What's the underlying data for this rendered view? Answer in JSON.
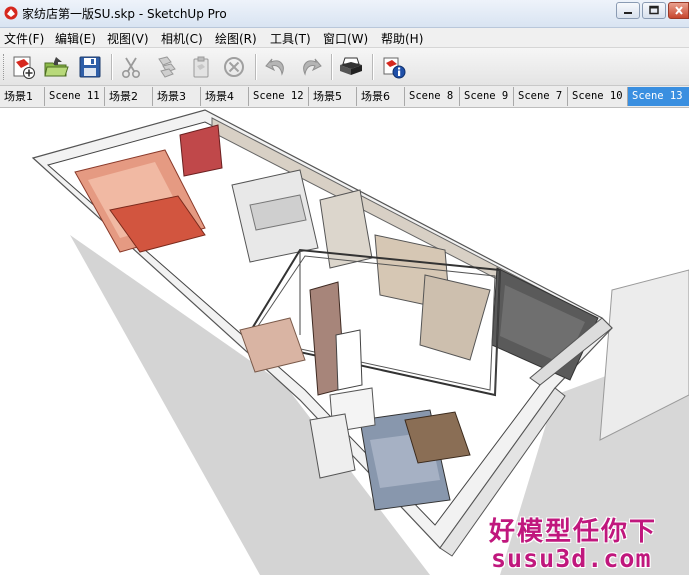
{
  "window": {
    "title": "家纺店第一版SU.skp - SketchUp Pro"
  },
  "menu": {
    "items": [
      {
        "label": "文件(F)"
      },
      {
        "label": "编辑(E)"
      },
      {
        "label": "视图(V)"
      },
      {
        "label": "相机(C)"
      },
      {
        "label": "绘图(R)"
      },
      {
        "label": "工具(T)"
      },
      {
        "label": "窗口(W)"
      },
      {
        "label": "帮助(H)"
      }
    ]
  },
  "toolbar": {
    "buttons": [
      {
        "icon": "new-file-icon"
      },
      {
        "icon": "open-folder-icon"
      },
      {
        "icon": "save-disk-icon"
      },
      {
        "icon": "cut-scissors-icon"
      },
      {
        "icon": "copy-icon"
      },
      {
        "icon": "paste-icon"
      },
      {
        "icon": "erase-icon"
      },
      {
        "icon": "undo-icon"
      },
      {
        "icon": "redo-icon"
      },
      {
        "icon": "print-icon"
      },
      {
        "icon": "model-info-icon"
      }
    ]
  },
  "scenes": {
    "tabs": [
      {
        "label": "场景1"
      },
      {
        "label": "Scene 11"
      },
      {
        "label": "场景2"
      },
      {
        "label": "场景3"
      },
      {
        "label": "场景4"
      },
      {
        "label": "Scene 12"
      },
      {
        "label": "场景5"
      },
      {
        "label": "场景6"
      },
      {
        "label": "Scene 8"
      },
      {
        "label": "Scene 9"
      },
      {
        "label": "Scene 7"
      },
      {
        "label": "Scene 10"
      },
      {
        "label": "Scene 13"
      }
    ],
    "active_index": 12
  },
  "watermark": {
    "line1": "好模型任你下",
    "line2": "susu3d.com"
  },
  "colors": {
    "active_tab": "#3a8fe0",
    "watermark": "#c0177d"
  }
}
